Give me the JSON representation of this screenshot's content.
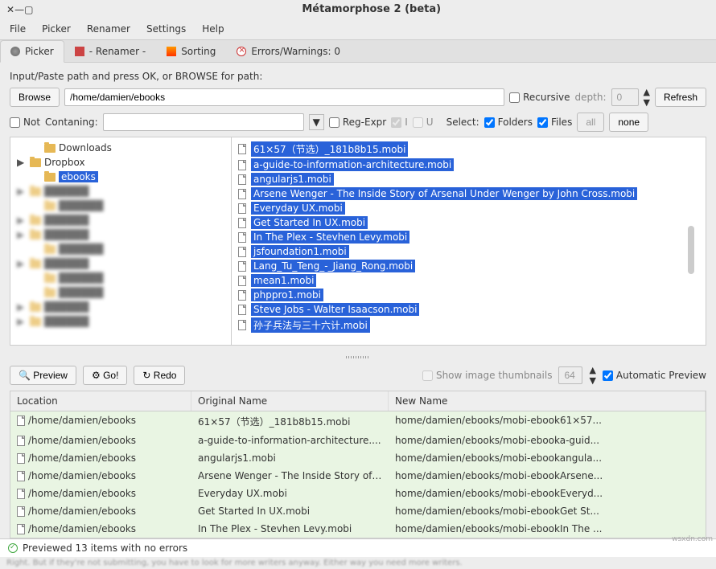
{
  "window": {
    "title": "Métamorphose 2 (beta)"
  },
  "menu": {
    "file": "File",
    "picker": "Picker",
    "renamer": "Renamer",
    "settings": "Settings",
    "help": "Help"
  },
  "tabs": {
    "picker": "Picker",
    "renamer": "- Renamer -",
    "sorting": "Sorting",
    "errors": "Errors/Warnings: 0"
  },
  "path_row": {
    "prompt": "Input/Paste path and press OK, or BROWSE for path:",
    "browse": "Browse",
    "path_value": "/home/damien/ebooks",
    "recursive": "Recursive",
    "depth_label": "depth:",
    "depth_value": "0",
    "refresh": "Refresh"
  },
  "filter_row": {
    "not": "Not",
    "containing": "Contaning:",
    "regexpr": "Reg-Expr",
    "flag_i": "I",
    "flag_u": "U",
    "select": "Select:",
    "folders": "Folders",
    "files": "Files",
    "all": "all",
    "none": "none"
  },
  "tree": [
    {
      "label": "Downloads",
      "expand": "",
      "indent": 1
    },
    {
      "label": "Dropbox",
      "expand": "▶",
      "indent": 0
    },
    {
      "label": "ebooks",
      "expand": "",
      "indent": 1,
      "selected": true
    },
    {
      "label": "",
      "expand": "▶",
      "indent": 0,
      "blurred": true
    },
    {
      "label": "",
      "expand": "",
      "indent": 1,
      "blurred": true
    },
    {
      "label": "",
      "expand": "▶",
      "indent": 0,
      "blurred": true
    },
    {
      "label": "",
      "expand": "▶",
      "indent": 0,
      "blurred": true
    },
    {
      "label": "",
      "expand": "",
      "indent": 1,
      "blurred": true
    },
    {
      "label": "",
      "expand": "▶",
      "indent": 0,
      "blurred": true
    },
    {
      "label": "",
      "expand": "",
      "indent": 1,
      "blurred": true
    },
    {
      "label": "",
      "expand": "",
      "indent": 1,
      "blurred": true
    },
    {
      "label": "",
      "expand": "▶",
      "indent": 0,
      "blurred": true
    },
    {
      "label": "",
      "expand": "▶",
      "indent": 0,
      "blurred": true
    }
  ],
  "files": [
    "61×57（节选）_181b8b15.mobi",
    "a-guide-to-information-architecture.mobi",
    "angularjs1.mobi",
    "Arsene Wenger - The Inside Story of Arsenal Under Wenger by John Cross.mobi",
    "Everyday UX.mobi",
    "Get Started In UX.mobi",
    "In The Plex - Stevhen Levy.mobi",
    "jsfoundation1.mobi",
    "Lang_Tu_Teng_-_Jiang_Rong.mobi",
    "mean1.mobi",
    "phppro1.mobi",
    "Steve Jobs - Walter Isaacson.mobi",
    "孙子兵法与三十六计.mobi"
  ],
  "actions": {
    "preview": "Preview",
    "go": "Go!",
    "redo": "Redo",
    "thumbs": "Show image thumbnails",
    "thumb_size": "64",
    "auto_preview": "Automatic Preview"
  },
  "table": {
    "col_location": "Location",
    "col_original": "Original Name",
    "col_newname": "New Name",
    "rows": [
      {
        "loc": "/home/damien/ebooks",
        "orig": "61×57（节选）_181b8b15.mobi",
        "newn": "home/damien/ebooks/mobi-ebook61×57..."
      },
      {
        "loc": "/home/damien/ebooks",
        "orig": "a-guide-to-information-architecture....",
        "newn": "home/damien/ebooks/mobi-ebooka-guid..."
      },
      {
        "loc": "/home/damien/ebooks",
        "orig": "angularjs1.mobi",
        "newn": "home/damien/ebooks/mobi-ebookangula..."
      },
      {
        "loc": "/home/damien/ebooks",
        "orig": "Arsene Wenger - The Inside Story of ...",
        "newn": "home/damien/ebooks/mobi-ebookArsene..."
      },
      {
        "loc": "/home/damien/ebooks",
        "orig": "Everyday UX.mobi",
        "newn": "home/damien/ebooks/mobi-ebookEveryd..."
      },
      {
        "loc": "/home/damien/ebooks",
        "orig": "Get Started In UX.mobi",
        "newn": "home/damien/ebooks/mobi-ebookGet St..."
      },
      {
        "loc": "/home/damien/ebooks",
        "orig": "In The Plex - Stevhen Levy.mobi",
        "newn": "home/damien/ebooks/mobi-ebookIn The ..."
      }
    ]
  },
  "status": {
    "message": "Previewed 13 items with no errors"
  },
  "watermark": "wsxdn.com"
}
